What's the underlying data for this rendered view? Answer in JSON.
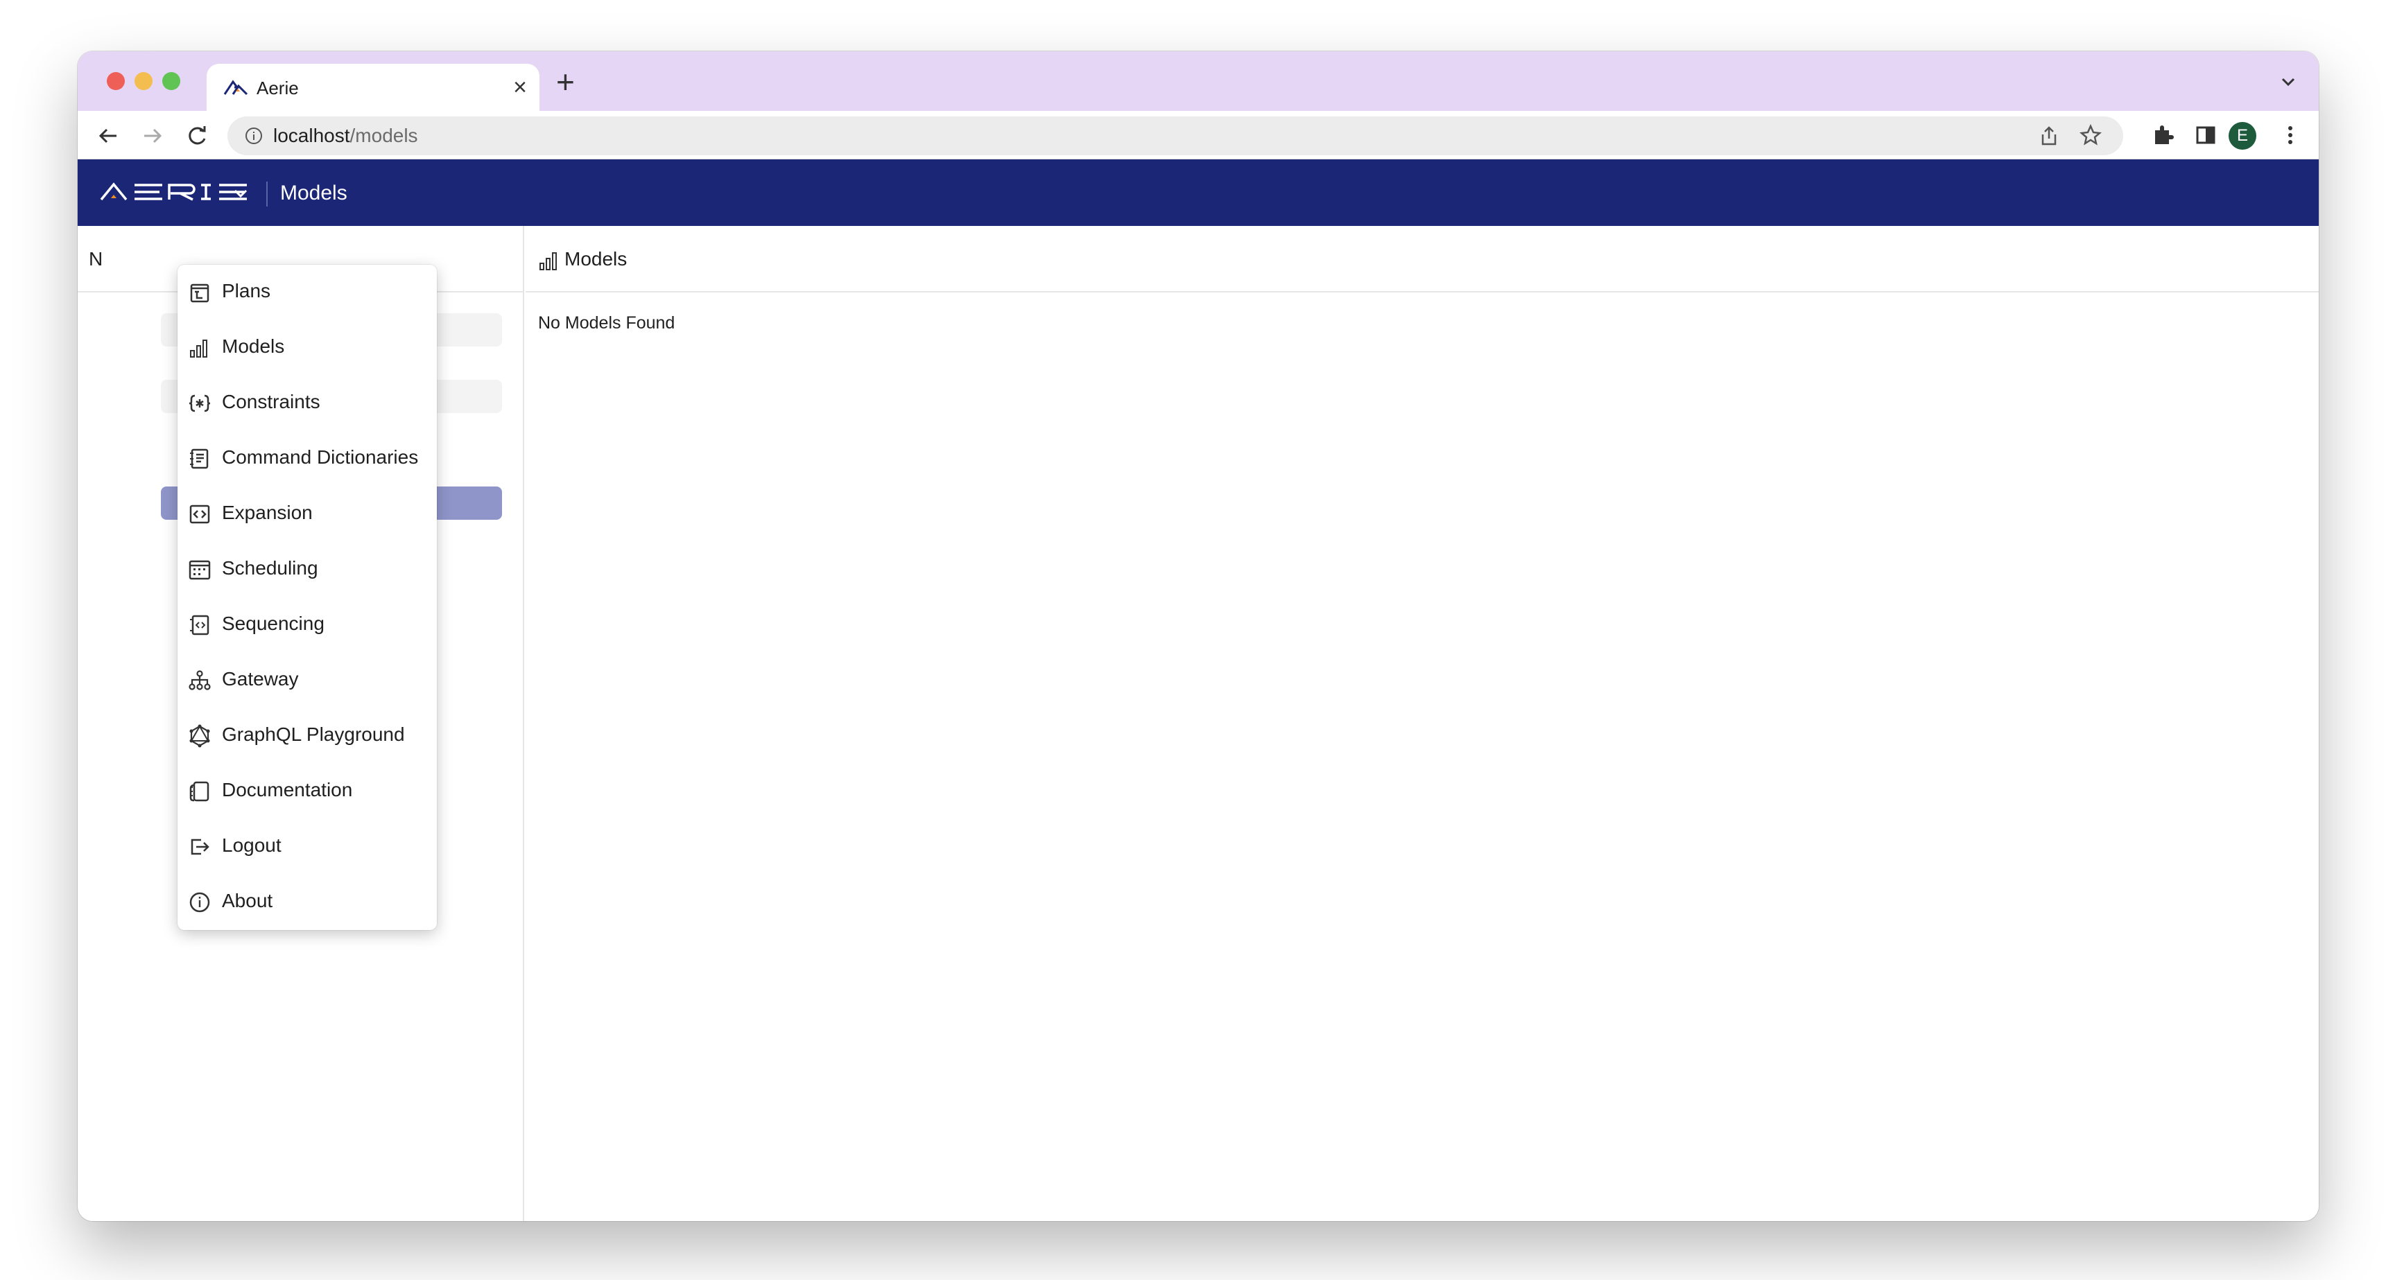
{
  "browser": {
    "tab_title": "Aerie",
    "url_host": "localhost",
    "url_path": "/models",
    "profile_initial": "E"
  },
  "app": {
    "logo_text": "AERIE",
    "header_title": "Models",
    "left_pane_header_letter": "N",
    "right_pane_title": "Models",
    "empty_message": "No Models Found",
    "brand_color": "#1c2677"
  },
  "menu": {
    "items": [
      {
        "label": "Plans",
        "icon": "plans-icon"
      },
      {
        "label": "Models",
        "icon": "models-icon"
      },
      {
        "label": "Constraints",
        "icon": "constraints-icon"
      },
      {
        "label": "Command Dictionaries",
        "icon": "command-dictionaries-icon"
      },
      {
        "label": "Expansion",
        "icon": "expansion-icon"
      },
      {
        "label": "Scheduling",
        "icon": "scheduling-icon"
      },
      {
        "label": "Sequencing",
        "icon": "sequencing-icon"
      },
      {
        "label": "Gateway",
        "icon": "gateway-icon"
      },
      {
        "label": "GraphQL Playground",
        "icon": "graphql-icon"
      },
      {
        "label": "Documentation",
        "icon": "documentation-icon"
      },
      {
        "label": "Logout",
        "icon": "logout-icon"
      },
      {
        "label": "About",
        "icon": "about-icon"
      }
    ]
  }
}
